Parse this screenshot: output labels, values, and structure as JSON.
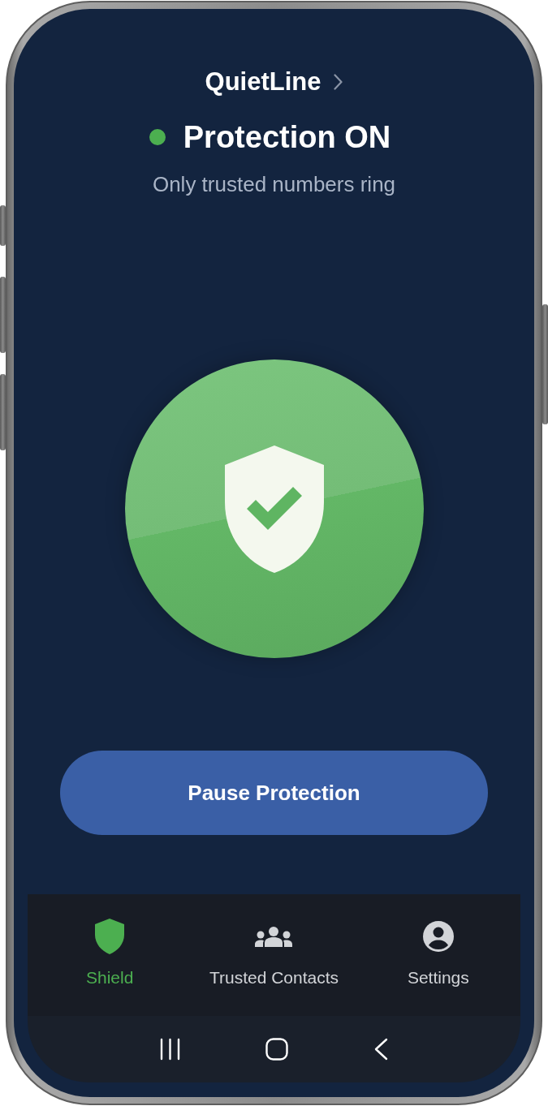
{
  "app_header": {
    "title": "QuietLine"
  },
  "status": {
    "on": true,
    "label": "Protection ON",
    "subtitle": "Only trusted numbers ring"
  },
  "action_button": {
    "label": "Pause Protection"
  },
  "bottom_nav": [
    {
      "label": "Shield",
      "selected": true
    },
    {
      "label": "Trusted Contacts",
      "selected": false
    },
    {
      "label": "Settings",
      "selected": false
    }
  ]
}
